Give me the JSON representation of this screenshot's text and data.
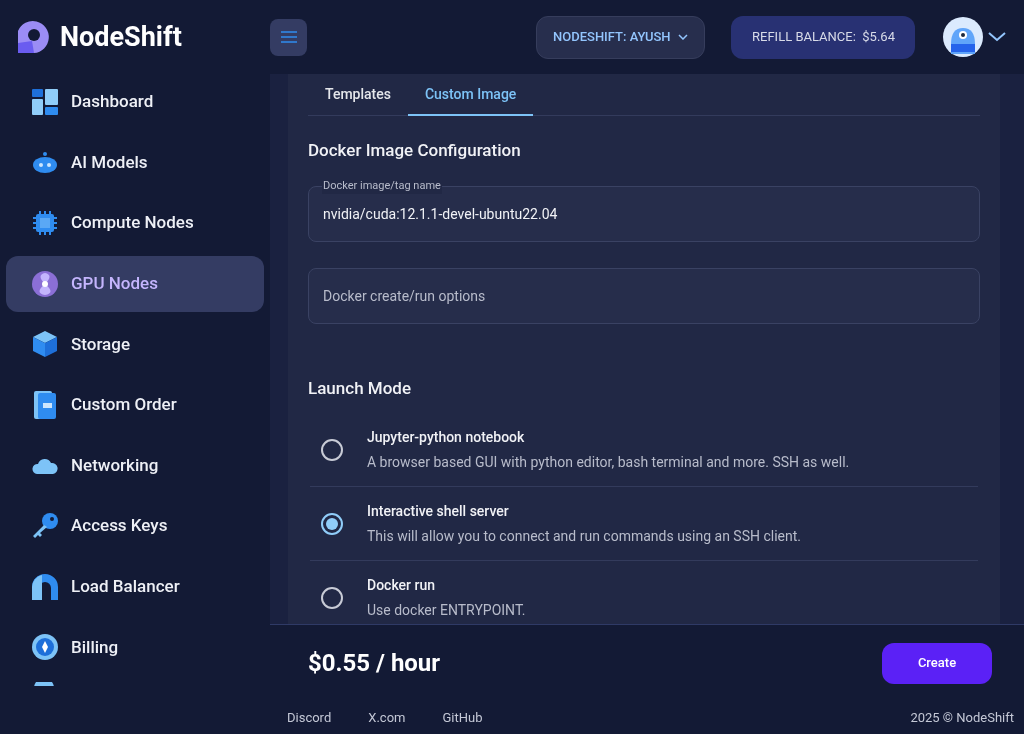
{
  "brand": {
    "name": "NodeShift"
  },
  "header": {
    "org_button": "NODESHIFT: AYUSH",
    "balance_button": "REFILL BALANCE:  $5.64"
  },
  "sidebar": {
    "items": [
      {
        "label": "Dashboard",
        "selected": false
      },
      {
        "label": "AI Models",
        "selected": false
      },
      {
        "label": "Compute Nodes",
        "selected": false
      },
      {
        "label": "GPU Nodes",
        "selected": true
      },
      {
        "label": "Storage",
        "selected": false
      },
      {
        "label": "Custom Order",
        "selected": false
      },
      {
        "label": "Networking",
        "selected": false
      },
      {
        "label": "Access Keys",
        "selected": false
      },
      {
        "label": "Load Balancer",
        "selected": false
      },
      {
        "label": "Billing",
        "selected": false
      }
    ]
  },
  "tabs": [
    {
      "label": "Templates",
      "selected": false
    },
    {
      "label": "Custom Image",
      "selected": true
    }
  ],
  "docker_config": {
    "title": "Docker Image Configuration",
    "image_field": {
      "label": "Docker image/tag name",
      "value": "nvidia/cuda:12.1.1-devel-ubuntu22.04"
    },
    "options_field": {
      "placeholder": "Docker create/run options"
    }
  },
  "launch_mode": {
    "title": "Launch Mode",
    "options": [
      {
        "title": "Jupyter-python notebook",
        "description": "A browser based GUI with python editor, bash terminal and more. SSH as well.",
        "selected": false
      },
      {
        "title": "Interactive shell server",
        "description": "This will allow you to connect and run commands using an SSH client.",
        "selected": true
      },
      {
        "title": "Docker run",
        "description": "Use docker ENTRYPOINT.",
        "selected": false
      }
    ]
  },
  "footer": {
    "price": "$0.55 / hour",
    "create_button": "Create",
    "links": [
      "Discord",
      "X.com",
      "GitHub"
    ],
    "copyright": "2025 © NodeShift"
  }
}
